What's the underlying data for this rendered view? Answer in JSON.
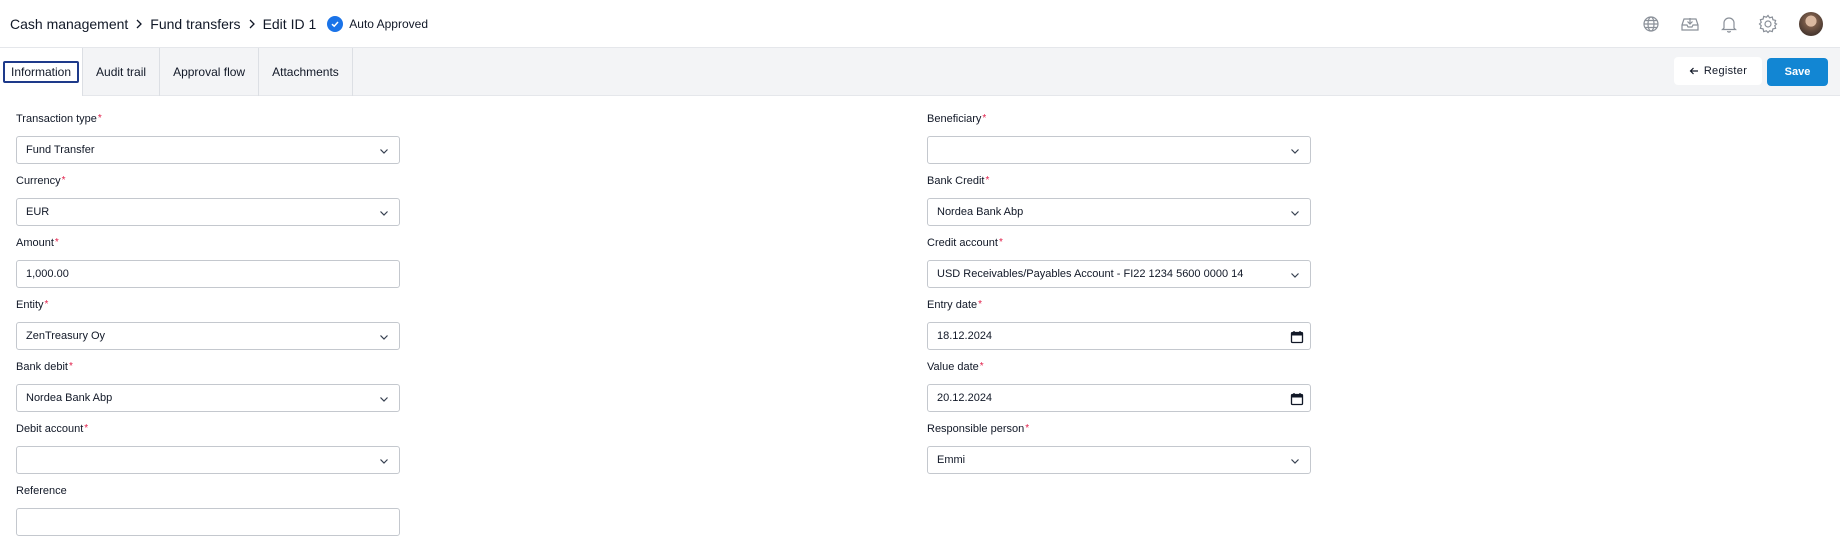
{
  "header": {
    "breadcrumbs": [
      "Cash management",
      "Fund transfers",
      "Edit ID 1"
    ],
    "status": "Auto Approved",
    "icons": [
      "globe-icon",
      "download-tray-icon",
      "bell-icon",
      "gear-icon",
      "avatar"
    ]
  },
  "tabs": [
    {
      "label": "Information",
      "active": true
    },
    {
      "label": "Audit trail",
      "active": false
    },
    {
      "label": "Approval flow",
      "active": false
    },
    {
      "label": "Attachments",
      "active": false
    }
  ],
  "actions": {
    "register_label": "Register",
    "save_label": "Save"
  },
  "form": {
    "left": {
      "transaction_type": {
        "label": "Transaction type",
        "value": "Fund Transfer",
        "required": true
      },
      "currency": {
        "label": "Currency",
        "value": "EUR",
        "required": true
      },
      "amount": {
        "label": "Amount",
        "value": "1,000.00",
        "required": true
      },
      "entity": {
        "label": "Entity",
        "value": "ZenTreasury Oy",
        "required": true
      },
      "bank_debit": {
        "label": "Bank debit",
        "value": "Nordea Bank Abp",
        "required": true
      },
      "debit_account": {
        "label": "Debit account",
        "value": "",
        "required": true
      },
      "reference": {
        "label": "Reference",
        "value": "",
        "required": false
      }
    },
    "right": {
      "beneficiary": {
        "label": "Beneficiary",
        "value": "",
        "required": true
      },
      "bank_credit": {
        "label": "Bank Credit",
        "value": "Nordea Bank Abp",
        "required": true
      },
      "credit_account": {
        "label": "Credit account",
        "value": "USD Receivables/Payables Account - FI22 1234 5600 0000 14",
        "required": true
      },
      "entry_date": {
        "label": "Entry date",
        "value": "18.12.2024",
        "required": true
      },
      "value_date": {
        "label": "Value date",
        "value": "20.12.2024",
        "required": true
      },
      "responsible_person": {
        "label": "Responsible person",
        "value": "Emmi",
        "required": true
      }
    }
  },
  "colors": {
    "accent": "#1286d3",
    "status_badge": "#1a73e8",
    "required_marker": "#e11d48",
    "tabbar_bg": "#f3f4f6"
  }
}
